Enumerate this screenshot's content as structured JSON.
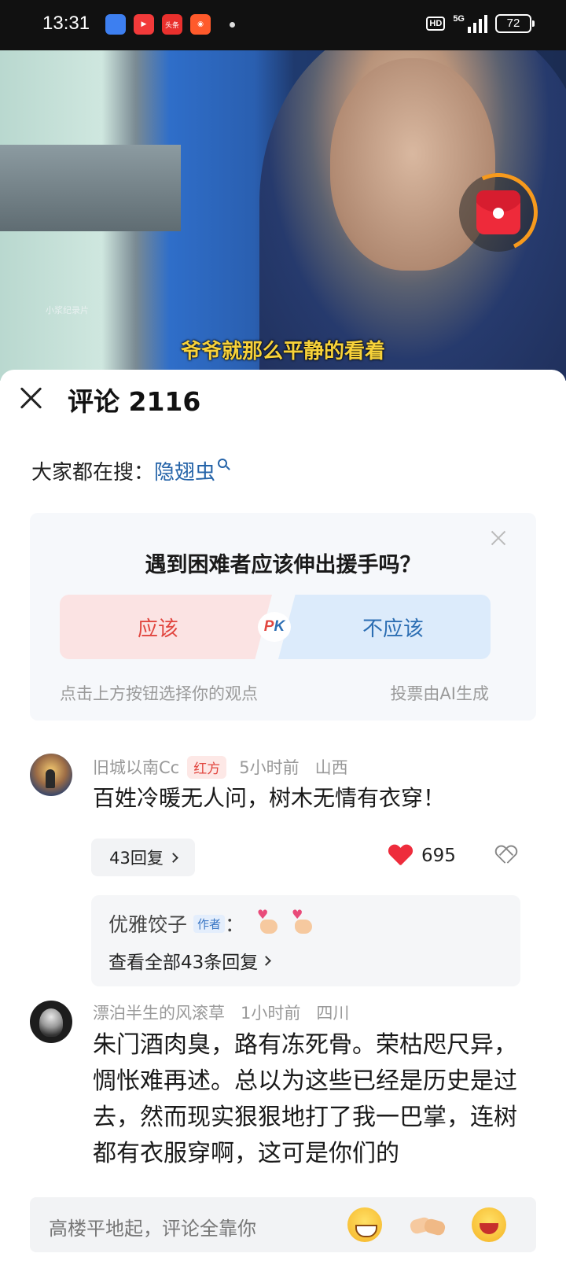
{
  "status_bar": {
    "time": "13:31",
    "app_icons": [
      "blue-app-icon",
      "video-app-icon",
      "toutiao-app-icon",
      "kuaishou-app-icon"
    ],
    "toutiao_label": "头条",
    "hd": "HD",
    "network": "5G",
    "battery": "72"
  },
  "video": {
    "watermark": "小浆纪录片",
    "subtitle": "爷爷就那么平静的看着"
  },
  "sheet": {
    "title": "评论 2116",
    "hot_search_label": "大家都在搜：",
    "hot_search_term": "隐翅虫"
  },
  "vote": {
    "question": "遇到困难者应该伸出援手吗？",
    "yes_label": "应该",
    "no_label": "不应该",
    "pk_p": "P",
    "pk_k": "K",
    "hint": "点击上方按钮选择你的观点",
    "ai_note": "投票由AI生成"
  },
  "comments": [
    {
      "author": "旧城以南Cc",
      "tag": "红方",
      "time": "5小时前",
      "location": "山西",
      "text": "百姓冷暖无人问，树木无情有衣穿！",
      "reply_count_label": "43回复",
      "likes": "695",
      "sub_reply": {
        "author": "优雅饺子",
        "author_tag": "作者",
        "colon": "：",
        "view_all": "查看全部43条回复"
      }
    },
    {
      "author": "漂泊半生的风滚草",
      "time": "1小时前",
      "location": "四川",
      "text": "朱门酒肉臭，路有冻死骨。荣枯咫尺异，惆怅难再述。总以为这些已经是历史是过去，然而现实狠狠地打了我一巴掌，连树都有衣服穿啊，这可是你们的"
    }
  ],
  "input": {
    "placeholder": "高楼平地起，评论全靠你",
    "emojis": [
      "grin-emoji",
      "handshake-emoji",
      "laugh-emoji"
    ]
  },
  "colors": {
    "accent_blue": "#2463a8",
    "accent_red": "#e1463f",
    "like_red": "#ee2c3c"
  }
}
